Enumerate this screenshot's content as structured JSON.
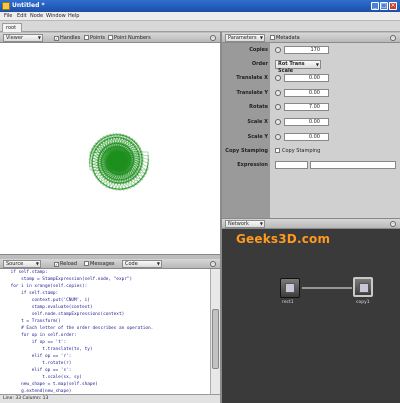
{
  "window": {
    "title": "Untitled *",
    "buttons": [
      "_",
      "□",
      "×"
    ]
  },
  "menubar": {
    "items": [
      "File",
      "Edit",
      "Node",
      "Window",
      "Help"
    ]
  },
  "document_tabs": [
    {
      "label": "root"
    }
  ],
  "viewer": {
    "mode": "Viewer",
    "options": [
      {
        "label": "Handles",
        "checked": true
      },
      {
        "label": "Points",
        "checked": false
      },
      {
        "label": "Point Numbers",
        "checked": false
      }
    ],
    "artwork_color": "#1f8f1f"
  },
  "parameters_panel": {
    "mode": "Parameters",
    "metadata_label": "Metadata",
    "rows": [
      {
        "label": "Copies",
        "value": "170"
      },
      {
        "label": "Order",
        "value": "Rot Trans Scale",
        "type": "select"
      },
      {
        "label": "Translate X",
        "value": "0.00"
      },
      {
        "label": "Translate Y",
        "value": "0.00"
      },
      {
        "label": "Rotate",
        "value": "7.00"
      },
      {
        "label": "Scale X",
        "value": "0.00"
      },
      {
        "label": "Scale Y",
        "value": "0.00"
      },
      {
        "label": "Copy Stamping",
        "value": "Copy Stamping",
        "type": "checkbox"
      },
      {
        "label": "Expression",
        "value": "",
        "type": "text"
      }
    ]
  },
  "network_panel": {
    "mode": "Network",
    "watermark": "Geeks3D.com",
    "nodes": [
      {
        "name": "rect1"
      },
      {
        "name": "copy1"
      }
    ]
  },
  "source_panel": {
    "mode": "Source",
    "reload_label": "Reload",
    "messages_label": "Messages",
    "code_mode": "Code",
    "lines": [
      "    if self.stamp:",
      "        stamp = StampExpression(self.node, \"expr\")",
      "    for i in xrange(self.copies):",
      "        if self.stamp:",
      "            context.put('CNUM', i)",
      "            stamp.evaluate(context)",
      "            self.node.stampExpressions(context)",
      "        t = Transform()",
      "        # Each letter of the order describes an operation.",
      "        for op in self.order:",
      "            if op == 't':",
      "                t.translate(tx, ty)",
      "            elif op == 'r':",
      "                t.rotate(r)",
      "            elif op == 's':",
      "                t.scale(sx, sy)",
      "        new_shape = t.map(self.shape)",
      "        g.extend(new_shape)"
    ]
  },
  "statusbar": {
    "text": "Line: 33  Column: 13"
  }
}
